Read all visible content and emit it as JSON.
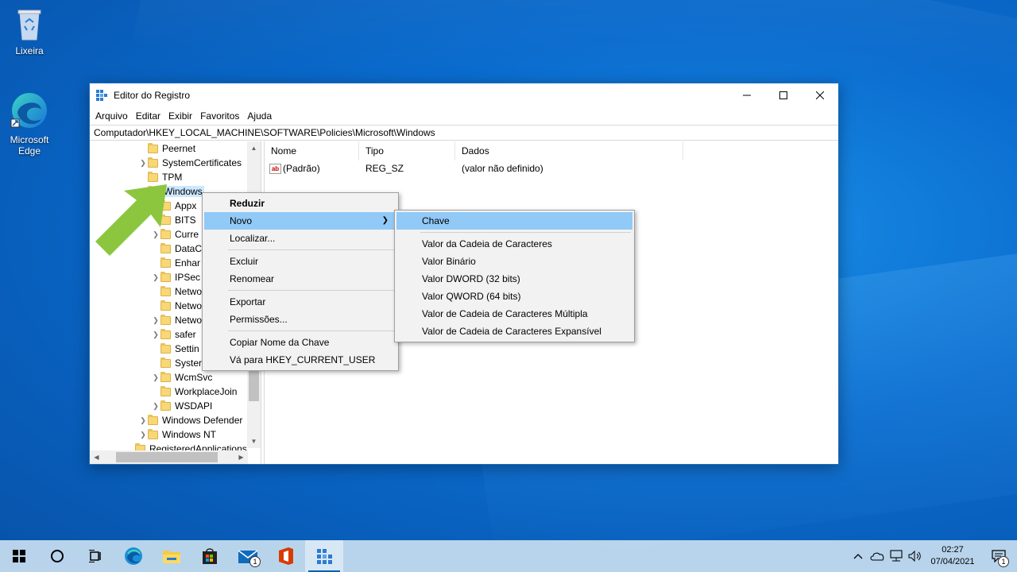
{
  "desktop": {
    "icons": [
      {
        "label": "Lixeira",
        "icon": "recycle-bin-icon"
      },
      {
        "label": "Microsoft Edge",
        "icon": "edge-icon"
      }
    ]
  },
  "window": {
    "title": "Editor do Registro",
    "menu": [
      "Arquivo",
      "Editar",
      "Exibir",
      "Favoritos",
      "Ajuda"
    ],
    "address": "Computador\\HKEY_LOCAL_MACHINE\\SOFTWARE\\Policies\\Microsoft\\Windows",
    "tree": [
      "Peernet",
      "SystemCertificates",
      "TPM",
      "Windows",
      "Appx",
      "BITS",
      "Curre",
      "DataC",
      "Enhar",
      "IPSec",
      "Netwo",
      "Netwo",
      "Netwo",
      "safer",
      "Settin",
      "Syster",
      "WcmSvc",
      "WorkplaceJoin",
      "WSDAPI",
      "Windows Defender",
      "Windows NT",
      "RegisteredApplications"
    ],
    "columns": [
      "Nome",
      "Tipo",
      "Dados"
    ],
    "values": [
      {
        "name": "(Padrão)",
        "type": "REG_SZ",
        "data": "(valor não definido)"
      }
    ]
  },
  "context_menu": {
    "items": [
      "Reduzir",
      "Novo",
      "Localizar...",
      "Excluir",
      "Renomear",
      "Exportar",
      "Permissões...",
      "Copiar Nome da Chave",
      "Vá para HKEY_CURRENT_USER"
    ]
  },
  "submenu": {
    "items": [
      "Chave",
      "Valor da Cadeia de Caracteres",
      "Valor Binário",
      "Valor DWORD (32 bits)",
      "Valor QWORD (64 bits)",
      "Valor de Cadeia de Caracteres Múltipla",
      "Valor de Cadeia de Caracteres Expansível"
    ]
  },
  "taskbar": {
    "clock_time": "02:27",
    "clock_date": "07/04/2021",
    "mail_badge": "1",
    "notification_badge": "1"
  },
  "colors": {
    "highlight": "#91c9f7",
    "arrow": "#8cc63f",
    "accent": "#0063b1"
  }
}
